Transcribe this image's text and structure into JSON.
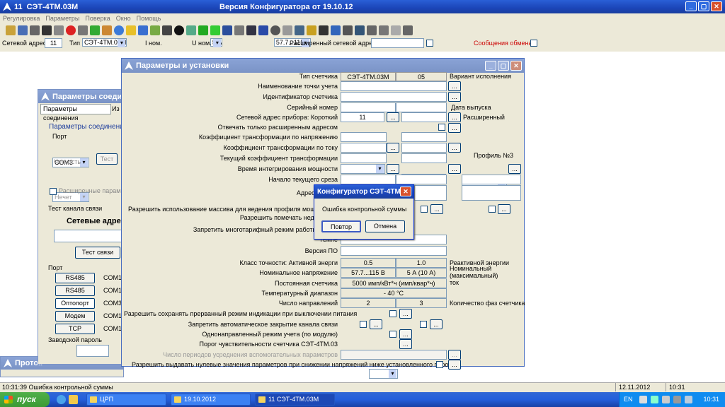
{
  "app": {
    "title_prefix": "11",
    "title_device": "СЭТ-4ТМ.03М",
    "title_center": "Версия Конфигуратора  от 19.10.12"
  },
  "menu": [
    "Регулировка",
    "Параметры",
    "Поверка",
    "Окно",
    "Помощь"
  ],
  "addr_bar": {
    "net_addr_label": "Сетевой адрес",
    "net_addr_value": "11",
    "type_label": "Тип",
    "type_value": "СЭТ-4ТМ.03М",
    "inom_label": "I ном.",
    "inom_value": "5 A",
    "unom_label": "U ном.",
    "unom_value": "57.7...115 В",
    "ext_addr_label": "Расширенный сетевой адрес",
    "msg_label": "Сообщения обмена"
  },
  "conn_window": {
    "title": "Параметры соединения",
    "tab1": "Параметры соединения",
    "tab2": "Из",
    "group": "Параметры соединения",
    "port_label": "Порт",
    "port_value": "COM3",
    "test_btn": "Тест",
    "parity_label": "Четность",
    "parity_value": "Нечет",
    "ext_params": "Расширенные параметр",
    "channel_test": "Тест канала связи",
    "net_addr": "Сетевые адре",
    "test_conn_btn": "Тест связи",
    "port_group": "Порт",
    "ports": [
      {
        "btn": "RS485",
        "com": "COM1"
      },
      {
        "btn": "RS485",
        "com": "COM1"
      },
      {
        "btn": "Оптопорт",
        "com": "COM3"
      },
      {
        "btn": "Модем",
        "com": "COM1"
      },
      {
        "btn": "TCP",
        "com": "COM1"
      }
    ],
    "factory_pwd": "Заводской пароль"
  },
  "proto_window": {
    "title": "Проток"
  },
  "params_window": {
    "title": "Параметры и установки",
    "rows": {
      "meter_type": "Тип счетчика",
      "meter_type_val": "СЭТ-4ТМ.03М",
      "meter_type_num": "05",
      "variant": "Вариант исполнения",
      "point_name": "Наименование точки учета",
      "meter_id": "Идентификатор счетчика",
      "serial": "Серийный номер",
      "release_date": "Дата выпуска",
      "net_addr": "Сетевой адрес прибора: Короткий",
      "net_addr_val": "11",
      "extended": "Расширенный",
      "reply_ext": "Отвечать только расширенным адресом",
      "kt_voltage": "Коэффициент трансформации по напряжению",
      "kt_current": "Коэффициент трансформации по току",
      "kt_current_now": "Текущий коэффициент трансформации",
      "profile3": "Профиль №3",
      "integration": "Время интегрирования мощности",
      "slice_start": "Начало текущего среза",
      "cur_addr": "Адрес текуще",
      "allow_profile": "Разрешить использование массива для ведения профиля мощност",
      "allow_mark": "Разрешить помечать недостовер",
      "forbid_multi": "Запретить многотарифный режим работы тариф",
      "temp": "Темпе",
      "fw": "Версия ПО",
      "accuracy": "Класс точности: Активной энерги",
      "acc_active": "0.5",
      "acc_reactive": "1.0",
      "reactive": "Реактивной энергии",
      "nominal_voltage": "Номинальное напряжение",
      "nv_val": "57.7...115 В",
      "nc_val": "5 А (10 А)",
      "nominal_current": "Номинальный (максимальный) ток",
      "constant": "Постоянная счетчика",
      "constant_val": "5000 имп/кВт*ч (имп/квар*ч)",
      "temp_range": "Температурный диапазон",
      "temp_range_val": "- 40 °С",
      "directions": "Число направлений",
      "directions_val": "2",
      "phases_val": "3",
      "phases": "Количество фаз счетчика",
      "save_break": "Разрешить сохранять прерванный режим индикации при выключении питания",
      "forbid_close": "Запретить автоматическое закрытие канала связи",
      "unidirect": "Однонаправленный режим учета (по модулю)",
      "sensitivity": "Порог чувствительности счетчика СЭТ-4ТМ.03",
      "aux_periods": "Число периодов усреднения вспомогательных параметров",
      "zero_values": "Разрешить выдавать нулевые значения параметров при снижении напряжений ниже установленного порога"
    },
    "dots": "..."
  },
  "dialog": {
    "title": "Конфигуратор СЭТ-4ТМ",
    "message": "Ошибка контрольной суммы",
    "retry": "Повтор",
    "cancel": "Отмена"
  },
  "status_bar": {
    "message": "10:31:39  Ошибка контрольной суммы",
    "date": "12.11.2012",
    "time": "10:31"
  },
  "taskbar": {
    "start": "пуск",
    "tasks": [
      "ЦРП",
      "19.10.2012",
      "11  СЭТ-4ТМ.03М"
    ],
    "lang": "EN",
    "clock": "10:31"
  },
  "colors": {
    "title_blue": "#1b45b8",
    "desktop": "#ece9d8",
    "taskbar": "#245edb",
    "start": "#3c9a34"
  }
}
